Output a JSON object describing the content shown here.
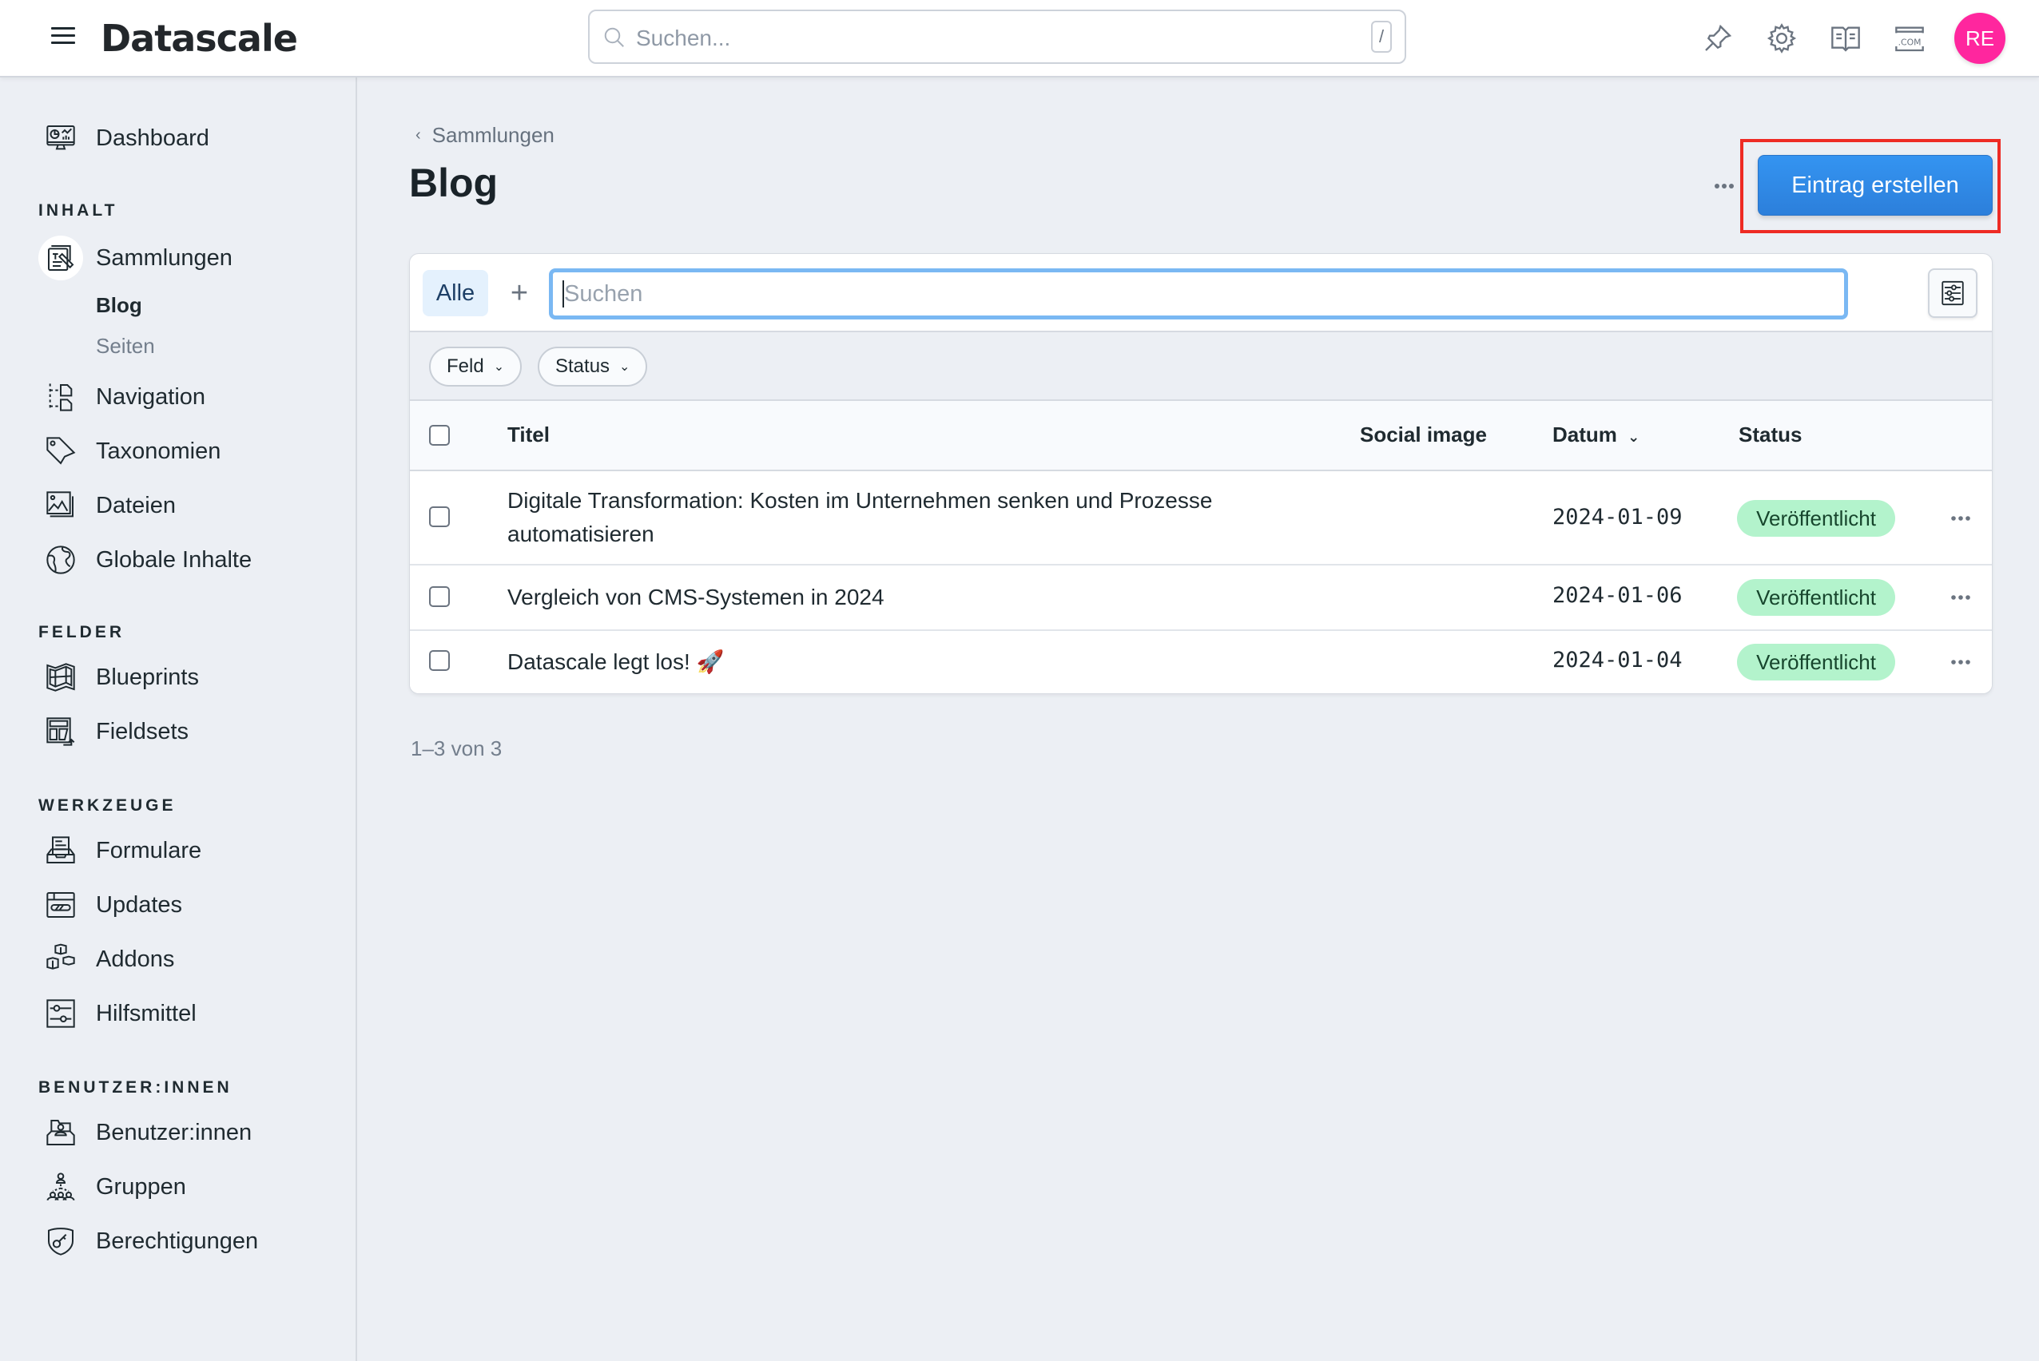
{
  "app": {
    "name": "Datascale",
    "search_placeholder": "Suchen...",
    "search_shortcut": "/",
    "header_icons": [
      "pin-icon",
      "gear-icon",
      "book-icon",
      "domain-icon"
    ],
    "avatar_initials": "RE",
    "avatar_color": "#ff269e"
  },
  "sidebar": {
    "dashboard": "Dashboard",
    "sections": [
      {
        "title": "INHALT",
        "items": [
          {
            "label": "Sammlungen",
            "icon": "collections-icon",
            "active": true,
            "children": [
              {
                "label": "Blog",
                "current": true
              },
              {
                "label": "Seiten",
                "current": false
              }
            ]
          },
          {
            "label": "Navigation",
            "icon": "navigation-icon"
          },
          {
            "label": "Taxonomien",
            "icon": "tag-icon"
          },
          {
            "label": "Dateien",
            "icon": "images-icon"
          },
          {
            "label": "Globale Inhalte",
            "icon": "globe-icon"
          }
        ]
      },
      {
        "title": "FELDER",
        "items": [
          {
            "label": "Blueprints",
            "icon": "map-icon"
          },
          {
            "label": "Fieldsets",
            "icon": "fieldsets-icon"
          }
        ]
      },
      {
        "title": "WERKZEUGE",
        "items": [
          {
            "label": "Formulare",
            "icon": "inbox-form-icon"
          },
          {
            "label": "Updates",
            "icon": "updates-icon"
          },
          {
            "label": "Addons",
            "icon": "boxes-icon"
          },
          {
            "label": "Hilfsmittel",
            "icon": "sliders-icon"
          }
        ]
      },
      {
        "title": "BENUTZER:INNEN",
        "items": [
          {
            "label": "Benutzer:innen",
            "icon": "users-folder-icon"
          },
          {
            "label": "Gruppen",
            "icon": "groups-icon"
          },
          {
            "label": "Berechtigungen",
            "icon": "shield-key-icon"
          }
        ]
      }
    ]
  },
  "main": {
    "breadcrumb": "Sammlungen",
    "title": "Blog",
    "create_button": "Eintrag erstellen",
    "accent_color": "#2f8ae8",
    "tabs": {
      "all": "Alle",
      "add": "+"
    },
    "table_search_placeholder": "Suchen",
    "filters": [
      "Feld",
      "Status"
    ],
    "columns": [
      "Titel",
      "Social image",
      "Datum",
      "Status"
    ],
    "sorted_column": "Datum",
    "rows": [
      {
        "title": "Digitale Transformation: Kosten im Unternehmen senken und Prozesse automatisieren",
        "social_image": "",
        "date": "2024-01-09",
        "status": "Veröffentlicht"
      },
      {
        "title": "Vergleich von CMS-Systemen in 2024",
        "social_image": "",
        "date": "2024-01-06",
        "status": "Veröffentlicht"
      },
      {
        "title": "Datascale legt los! 🚀",
        "social_image": "",
        "date": "2024-01-04",
        "status": "Veröffentlicht"
      }
    ],
    "status_color": "#b3f3cc",
    "pagination": "1–3 von 3"
  }
}
